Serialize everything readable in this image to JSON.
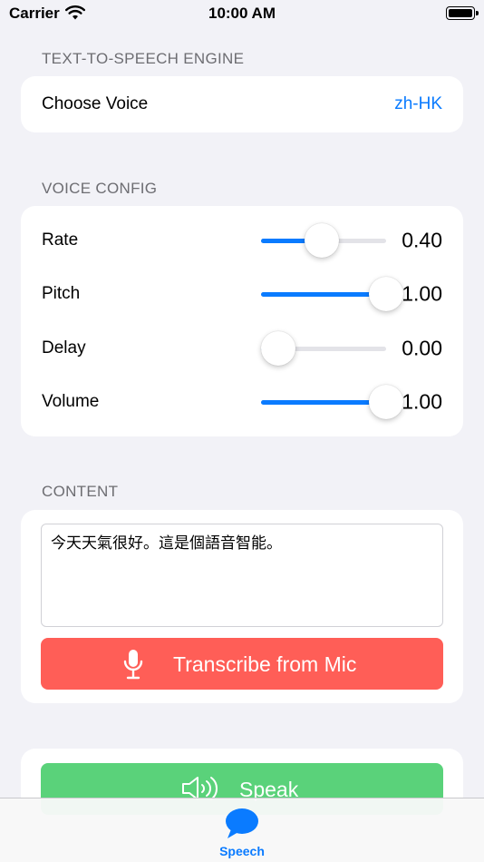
{
  "status_bar": {
    "carrier": "Carrier",
    "time": "10:00 AM"
  },
  "engine": {
    "header": "TEXT-TO-SPEECH ENGINE",
    "choose_voice_label": "Choose Voice",
    "voice_value": "zh-HK"
  },
  "config": {
    "header": "VOICE CONFIG",
    "sliders": [
      {
        "label": "Rate",
        "value": "0.40",
        "fraction": 0.4
      },
      {
        "label": "Pitch",
        "value": "1.00",
        "fraction": 1.0
      },
      {
        "label": "Delay",
        "value": "0.00",
        "fraction": 0.0
      },
      {
        "label": "Volume",
        "value": "1.00",
        "fraction": 1.0
      }
    ]
  },
  "content": {
    "header": "CONTENT",
    "text": "今天天氣很好。這是個語音智能。",
    "mic_button_label": "Transcribe from Mic"
  },
  "actions": {
    "speak_label": "Speak"
  },
  "tab_bar": {
    "items": [
      {
        "label": "Speech",
        "icon": "speech-bubble-icon",
        "selected": true
      }
    ]
  },
  "colors": {
    "accent": "#0a7bff",
    "mic": "#ff5e57",
    "speak": "#5ad27a",
    "background": "#f2f2f7"
  }
}
